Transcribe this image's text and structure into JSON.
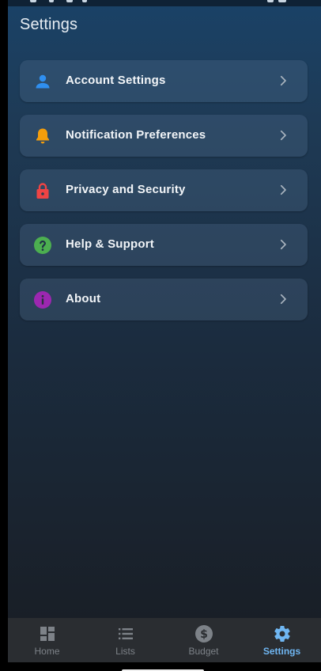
{
  "header": {
    "title": "Settings"
  },
  "menu": {
    "items": [
      {
        "label": "Account Settings",
        "icon": "person-icon",
        "icon_color": "#2f8ff0"
      },
      {
        "label": "Notification Preferences",
        "icon": "bell-icon",
        "icon_color": "#f59e0b"
      },
      {
        "label": "Privacy and Security",
        "icon": "lock-icon",
        "icon_color": "#ef4444"
      },
      {
        "label": "Help & Support",
        "icon": "help-circle-icon",
        "icon_color": "#4caf50"
      },
      {
        "label": "About",
        "icon": "info-icon",
        "icon_color": "#9c27b0"
      }
    ]
  },
  "bottom_nav": {
    "items": [
      {
        "label": "Home",
        "icon": "dashboard-icon",
        "active": false
      },
      {
        "label": "Lists",
        "icon": "list-icon",
        "active": false
      },
      {
        "label": "Budget",
        "icon": "dollar-circle-icon",
        "active": false
      },
      {
        "label": "Settings",
        "icon": "gear-icon",
        "active": true
      }
    ],
    "active_color": "#6fb6f2",
    "inactive_color": "#7d8288"
  }
}
